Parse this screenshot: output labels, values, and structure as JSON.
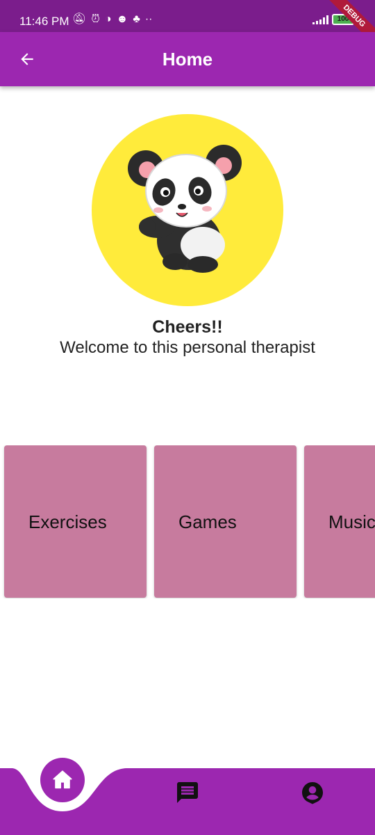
{
  "status_bar": {
    "time": "11:46 PM",
    "battery": "100",
    "debug_label": "DEBUG",
    "icons": [
      "muted-notification-icon",
      "alarm-icon",
      "data-saver-icon",
      "account-icon",
      "snapchat-icon",
      "more-dots-icon",
      "signal-icon",
      "battery-icon"
    ]
  },
  "app_bar": {
    "title": "Home",
    "back_icon": "arrow-back-icon",
    "color": "#9c27b0"
  },
  "hero": {
    "image": "panda-illustration",
    "circle_color": "#ffeb3b",
    "greeting": "Cheers!!",
    "subtitle": "Welcome to this personal therapist"
  },
  "cards": [
    {
      "label": "Exercises"
    },
    {
      "label": "Games"
    },
    {
      "label": "Music"
    }
  ],
  "card_color": "#c77b9e",
  "bottom_nav": {
    "color": "#9c27b0",
    "items": [
      {
        "icon": "home-icon",
        "selected": true
      },
      {
        "icon": "chat-icon",
        "selected": false
      },
      {
        "icon": "account-circle-icon",
        "selected": false
      }
    ]
  }
}
